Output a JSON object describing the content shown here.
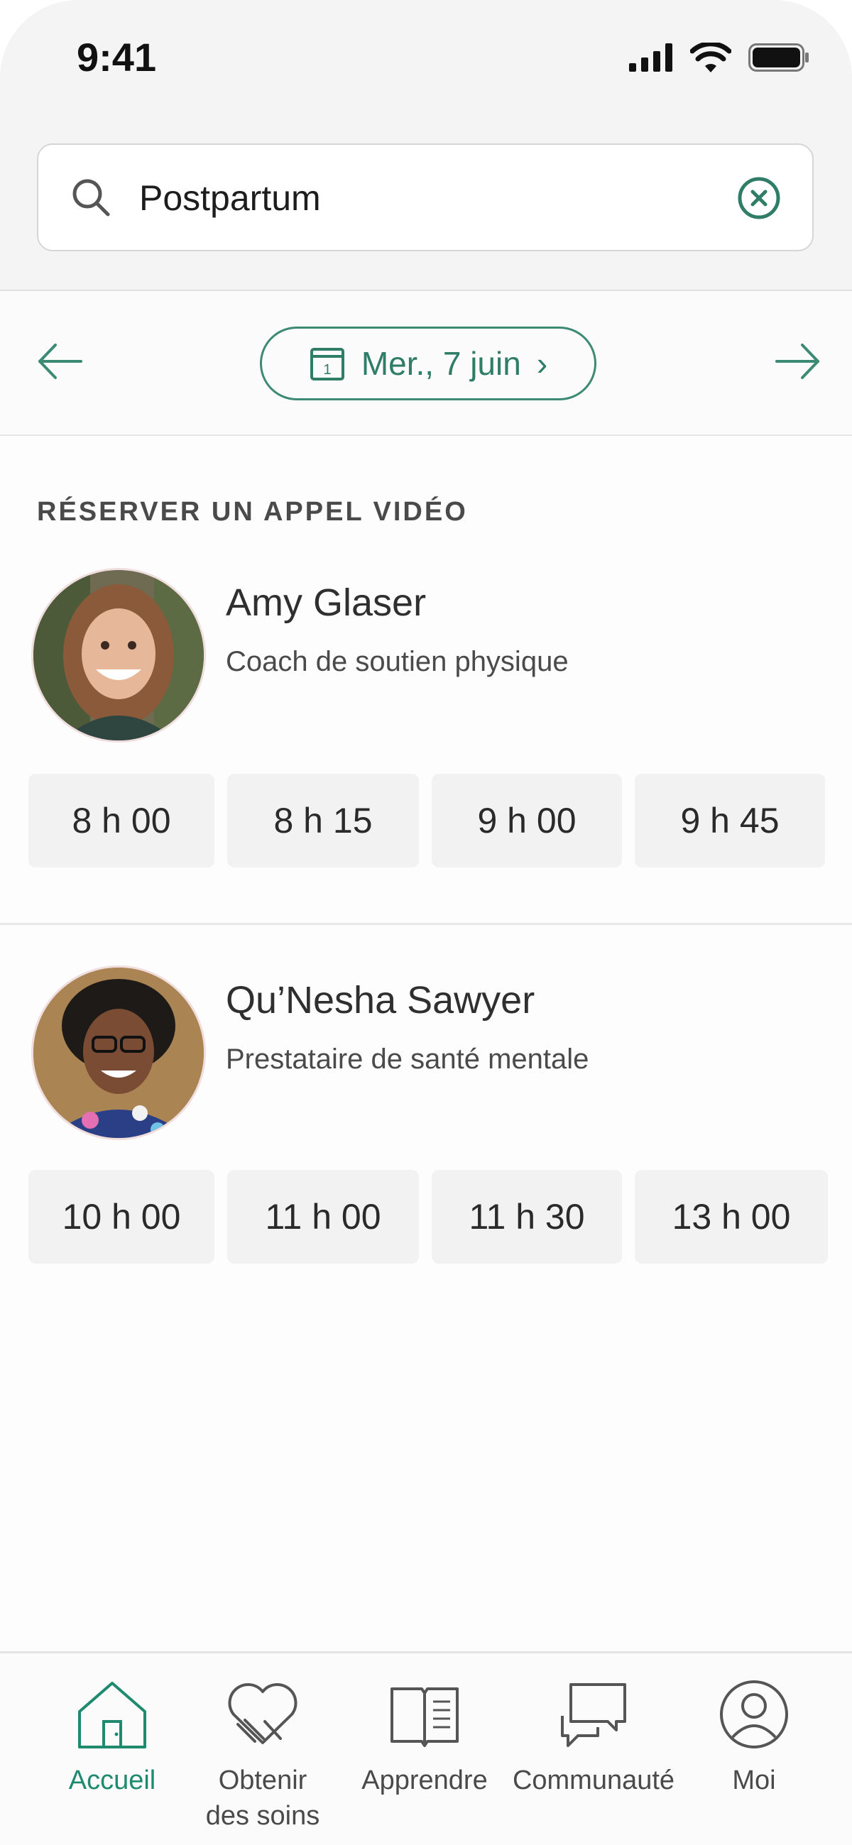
{
  "status_bar": {
    "time": "9:41"
  },
  "search": {
    "value": "Postpartum"
  },
  "date_nav": {
    "date_label": "Mer., 7 juin",
    "calendar_day": "1"
  },
  "booking": {
    "section_title": "RÉSERVER UN APPEL VIDÉO",
    "providers": [
      {
        "name": "Amy Glaser",
        "role": "Coach de soutien physique",
        "slots": [
          "8 h 00",
          "8 h 15",
          "9 h 00",
          "9 h 45"
        ]
      },
      {
        "name": "Qu’Nesha Sawyer",
        "role": "Prestataire de santé mentale",
        "slots": [
          "10 h 00",
          "11 h 00",
          "11 h 30",
          "13 h 00"
        ]
      }
    ]
  },
  "tabbar": {
    "items": [
      {
        "label": "Accueil",
        "icon": "home-icon",
        "active": true
      },
      {
        "label": "Obtenir\ndes soins",
        "icon": "heart-hands-icon"
      },
      {
        "label": "Apprendre",
        "icon": "book-icon"
      },
      {
        "label": "Communauté",
        "icon": "chat-bubbles-icon"
      },
      {
        "label": "Moi",
        "icon": "user-icon"
      }
    ]
  },
  "colors": {
    "accent": "#2f7d66",
    "tab_active": "#1f8a6f"
  }
}
